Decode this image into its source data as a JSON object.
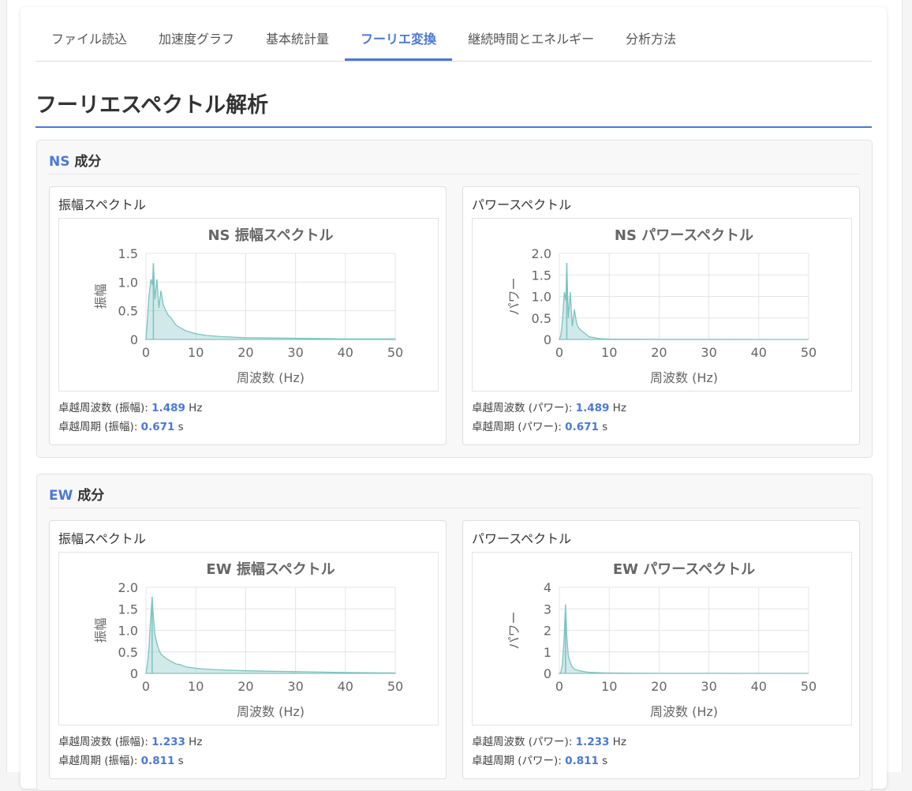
{
  "tabs": [
    {
      "label": "ファイル読込",
      "active": false
    },
    {
      "label": "加速度グラフ",
      "active": false
    },
    {
      "label": "基本統計量",
      "active": false
    },
    {
      "label": "フーリエ変換",
      "active": true
    },
    {
      "label": "継続時間とエネルギー",
      "active": false
    },
    {
      "label": "分析方法",
      "active": false
    }
  ],
  "page_title": "フーリエスペクトル解析",
  "sections": [
    {
      "component": "NS",
      "suffix": " 成分",
      "amp": {
        "panel_title": "振幅スペクトル",
        "freq_label": "卓越周波数 (振幅): ",
        "freq_value": "1.489",
        "freq_unit": " Hz",
        "period_label": "卓越周期 (振幅): ",
        "period_value": "0.671",
        "period_unit": " s"
      },
      "pow": {
        "panel_title": "パワースペクトル",
        "freq_label": "卓越周波数 (パワー): ",
        "freq_value": "1.489",
        "freq_unit": " Hz",
        "period_label": "卓越周期 (パワー): ",
        "period_value": "0.671",
        "period_unit": " s"
      }
    },
    {
      "component": "EW",
      "suffix": " 成分",
      "amp": {
        "panel_title": "振幅スペクトル",
        "freq_label": "卓越周波数 (振幅): ",
        "freq_value": "1.233",
        "freq_unit": " Hz",
        "period_label": "卓越周期 (振幅): ",
        "period_value": "0.811",
        "period_unit": " s"
      },
      "pow": {
        "panel_title": "パワースペクトル",
        "freq_label": "卓越周波数 (パワー): ",
        "freq_value": "1.233",
        "freq_unit": " Hz",
        "period_label": "卓越周期 (パワー): ",
        "period_value": "0.811",
        "period_unit": " s"
      }
    }
  ],
  "colors": {
    "accent": "#4a78d8",
    "series": "#7cc3c1"
  },
  "chart_data": [
    {
      "type": "line",
      "title": "NS 振幅スペクトル",
      "xlabel": "周波数 (Hz)",
      "ylabel": "振幅",
      "xlim": [
        0,
        50
      ],
      "ylim": [
        0,
        1.5
      ],
      "xticks": [
        "0",
        "10",
        "20",
        "30",
        "40",
        "50"
      ],
      "yticks": [
        "0",
        "0.5",
        "1.0",
        "1.5"
      ],
      "grid": true,
      "peak_x": 1.489,
      "peak_y": 1.33,
      "series": [
        {
          "x": [
            0.3,
            0.6,
            1.0,
            1.3,
            1.489,
            1.8,
            2.2,
            2.6,
            3.0,
            3.5,
            4.0,
            4.5,
            5.0,
            6.0,
            7.0,
            8.0,
            10.0,
            12.0,
            15.0,
            20.0,
            30.0,
            40.0,
            50.0
          ],
          "y": [
            0.35,
            0.75,
            1.05,
            0.95,
            1.33,
            0.7,
            1.05,
            0.55,
            0.85,
            0.6,
            0.5,
            0.42,
            0.38,
            0.25,
            0.2,
            0.15,
            0.1,
            0.07,
            0.05,
            0.03,
            0.02,
            0.01,
            0.01
          ]
        }
      ]
    },
    {
      "type": "line",
      "title": "NS パワースペクトル",
      "xlabel": "周波数 (Hz)",
      "ylabel": "パワー",
      "xlim": [
        0,
        50
      ],
      "ylim": [
        0,
        2.0
      ],
      "xticks": [
        "0",
        "10",
        "20",
        "30",
        "40",
        "50"
      ],
      "yticks": [
        "0",
        "0.5",
        "1.0",
        "1.5",
        "2.0"
      ],
      "grid": true,
      "peak_x": 1.489,
      "peak_y": 1.78,
      "series": [
        {
          "x": [
            0.3,
            0.6,
            1.0,
            1.3,
            1.489,
            1.8,
            2.2,
            2.6,
            3.0,
            3.5,
            4.0,
            4.5,
            5.0,
            6.0,
            8.0,
            10.0,
            15.0,
            20.0,
            30.0,
            50.0
          ],
          "y": [
            0.1,
            0.4,
            1.1,
            0.9,
            1.78,
            0.5,
            1.1,
            0.3,
            0.7,
            0.35,
            0.25,
            0.2,
            0.15,
            0.06,
            0.02,
            0.01,
            0.005,
            0.002,
            0.001,
            0.0
          ]
        }
      ]
    },
    {
      "type": "line",
      "title": "EW 振幅スペクトル",
      "xlabel": "周波数 (Hz)",
      "ylabel": "振幅",
      "xlim": [
        0,
        50
      ],
      "ylim": [
        0,
        2.0
      ],
      "xticks": [
        "0",
        "10",
        "20",
        "30",
        "40",
        "50"
      ],
      "yticks": [
        "0",
        "0.5",
        "1.0",
        "1.5",
        "2.0"
      ],
      "grid": true,
      "peak_x": 1.233,
      "peak_y": 1.78,
      "series": [
        {
          "x": [
            0.3,
            0.6,
            0.9,
            1.233,
            1.5,
            1.8,
            2.2,
            2.6,
            3.0,
            3.5,
            4.0,
            5.0,
            6.0,
            7.0,
            8.0,
            10.0,
            12.0,
            15.0,
            20.0,
            25.0,
            30.0,
            40.0,
            50.0
          ],
          "y": [
            0.2,
            0.6,
            1.2,
            1.78,
            1.3,
            0.9,
            0.7,
            0.55,
            0.45,
            0.4,
            0.35,
            0.28,
            0.22,
            0.2,
            0.15,
            0.12,
            0.1,
            0.08,
            0.06,
            0.05,
            0.04,
            0.02,
            0.01
          ]
        }
      ]
    },
    {
      "type": "line",
      "title": "EW パワースペクトル",
      "xlabel": "周波数 (Hz)",
      "ylabel": "パワー",
      "xlim": [
        0,
        50
      ],
      "ylim": [
        0,
        4
      ],
      "xticks": [
        "0",
        "10",
        "20",
        "30",
        "40",
        "50"
      ],
      "yticks": [
        "0",
        "1",
        "2",
        "3",
        "4"
      ],
      "grid": true,
      "peak_x": 1.233,
      "peak_y": 3.2,
      "series": [
        {
          "x": [
            0.3,
            0.6,
            0.9,
            1.233,
            1.5,
            1.8,
            2.2,
            2.6,
            3.0,
            4.0,
            5.0,
            6.0,
            8.0,
            10.0,
            20.0,
            30.0,
            50.0
          ],
          "y": [
            0.05,
            0.4,
            1.4,
            3.2,
            1.7,
            0.8,
            0.5,
            0.3,
            0.2,
            0.12,
            0.08,
            0.05,
            0.03,
            0.02,
            0.005,
            0.002,
            0.0
          ]
        }
      ]
    }
  ]
}
